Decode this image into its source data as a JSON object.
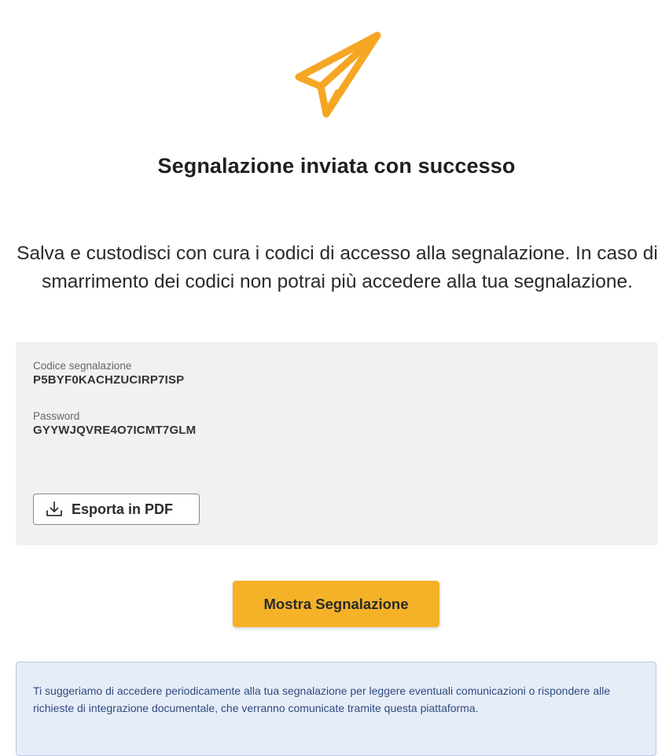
{
  "title": "Segnalazione inviata con successo",
  "subtitle": "Salva e custodisci con cura i codici di accesso alla segnalazione. In caso di smarrimento dei codici non potrai più accedere alla tua segnalazione.",
  "codes": {
    "code_label": "Codice segnalazione",
    "code_value": "P5BYF0KACHZUCIRP7ISP",
    "password_label": "Password",
    "password_value": "GYYWJQVRE4O7ICMT7GLM",
    "export_label": "Esporta in PDF"
  },
  "show_button_label": "Mostra Segnalazione",
  "info_text": "Ti suggeriamo di accedere periodicamente alla tua segnalazione per leggere eventuali comunicazioni o rispondere alle richieste di integrazione documentale, che verranno comunicate tramite questa piattaforma.",
  "icons": {
    "hero": "paper-plane-icon",
    "export": "download-icon"
  },
  "colors": {
    "accent": "#f5a623",
    "primary_button": "#f5b228",
    "info_background": "#e7edf8",
    "info_text": "#2e4a80",
    "codes_background": "#f2f1ef"
  }
}
